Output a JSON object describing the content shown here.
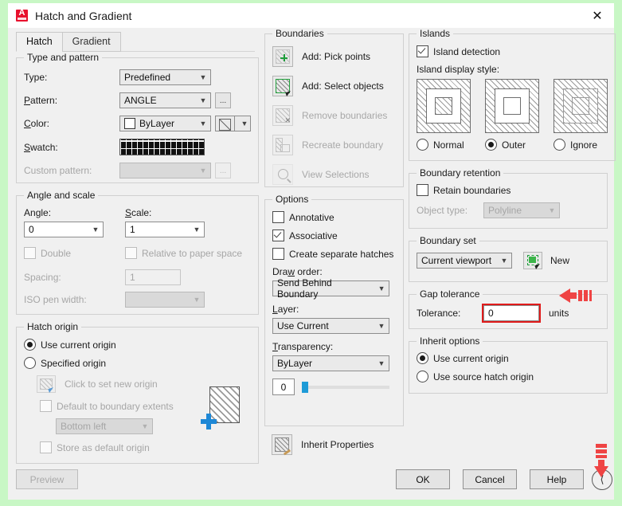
{
  "window": {
    "title": "Hatch and Gradient",
    "logo_icon": "autocad-logo-icon",
    "close_icon": "close-icon"
  },
  "tabs": [
    {
      "label": "Hatch",
      "active": true
    },
    {
      "label": "Gradient",
      "active": false
    }
  ],
  "type_and_pattern": {
    "legend": "Type and pattern",
    "type_label": "Type:",
    "type_value": "Predefined",
    "pattern_label": "Pattern:",
    "pattern_value": "ANGLE",
    "pattern_browse_label": "...",
    "color_label": "Color:",
    "color_value": "ByLayer",
    "swatch_label": "Swatch:",
    "swatch_pattern": "ANGLE",
    "custom_pattern_label": "Custom pattern:",
    "custom_pattern_value": "",
    "custom_browse_label": "..."
  },
  "angle_and_scale": {
    "legend": "Angle and scale",
    "angle_label": "Angle:",
    "angle_value": "0",
    "scale_label": "Scale:",
    "scale_value": "1",
    "double_label": "Double",
    "double_checked": false,
    "relative_label": "Relative to paper space",
    "relative_checked": false,
    "spacing_label": "Spacing:",
    "spacing_value": "1",
    "iso_pen_label": "ISO pen width:",
    "iso_pen_value": ""
  },
  "hatch_origin": {
    "legend": "Hatch origin",
    "use_current_label": "Use current origin",
    "use_current_selected": true,
    "specified_label": "Specified origin",
    "specified_selected": false,
    "click_set_label": "Click to set new origin",
    "default_extents_label": "Default to boundary extents",
    "default_extents_checked": false,
    "extents_value": "Bottom left",
    "store_default_label": "Store as default origin",
    "store_default_checked": false
  },
  "boundaries": {
    "legend": "Boundaries",
    "items": [
      {
        "label": "Add: Pick points",
        "icon": "pick-points-icon",
        "enabled": true
      },
      {
        "label": "Add: Select objects",
        "icon": "select-objects-icon",
        "enabled": true
      },
      {
        "label": "Remove boundaries",
        "icon": "remove-boundaries-icon",
        "enabled": false
      },
      {
        "label": "Recreate boundary",
        "icon": "recreate-boundary-icon",
        "enabled": false
      },
      {
        "label": "View Selections",
        "icon": "view-selections-icon",
        "enabled": false
      }
    ]
  },
  "options": {
    "legend": "Options",
    "annotative_label": "Annotative",
    "annotative_checked": false,
    "associative_label": "Associative",
    "associative_checked": true,
    "separate_hatches_label": "Create separate hatches",
    "separate_hatches_checked": false,
    "draw_order_label": "Draw order:",
    "draw_order_value": "Send Behind Boundary",
    "layer_label": "Layer:",
    "layer_value": "Use Current",
    "transparency_label": "Transparency:",
    "transparency_value": "ByLayer",
    "transparency_amount": "0",
    "inherit_properties_label": "Inherit Properties",
    "inherit_properties_icon": "inherit-properties-icon"
  },
  "islands": {
    "legend": "Islands",
    "detection_label": "Island detection",
    "detection_checked": true,
    "display_style_label": "Island display style:",
    "styles": [
      {
        "label": "Normal",
        "selected": false
      },
      {
        "label": "Outer",
        "selected": true
      },
      {
        "label": "Ignore",
        "selected": false
      }
    ]
  },
  "boundary_retention": {
    "legend": "Boundary retention",
    "retain_label": "Retain boundaries",
    "retain_checked": false,
    "object_type_label": "Object type:",
    "object_type_value": "Polyline"
  },
  "boundary_set": {
    "legend": "Boundary set",
    "value": "Current viewport",
    "new_button_label": "New",
    "new_icon": "new-boundary-set-icon"
  },
  "gap_tolerance": {
    "legend": "Gap tolerance",
    "tolerance_label": "Tolerance:",
    "tolerance_value": "0",
    "units_label": "units",
    "highlight_color": "#e01b1b"
  },
  "inherit_options": {
    "legend": "Inherit options",
    "use_current_label": "Use current origin",
    "use_current_selected": true,
    "use_source_label": "Use source hatch origin",
    "use_source_selected": false
  },
  "footer": {
    "preview_label": "Preview",
    "ok_label": "OK",
    "cancel_label": "Cancel",
    "help_label": "Help",
    "expand_icon": "chevron-left-circle-icon"
  },
  "annotations": [
    {
      "name": "tolerance-arrow",
      "color": "#ef4444",
      "direction": "left"
    },
    {
      "name": "expander-arrow",
      "color": "#ef4444",
      "direction": "down"
    }
  ]
}
